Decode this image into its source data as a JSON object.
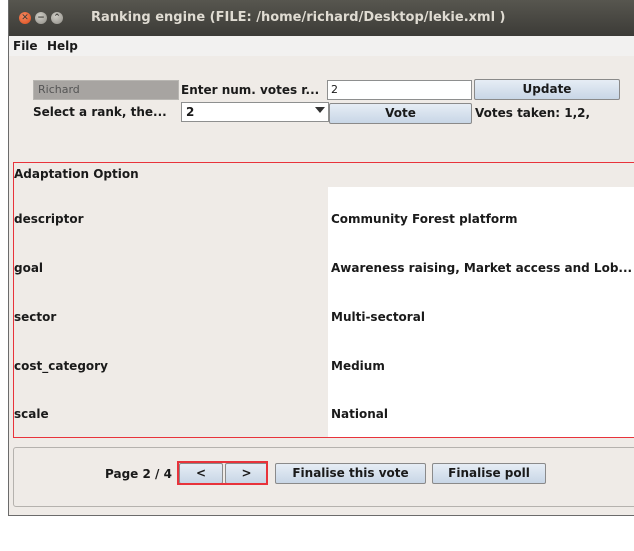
{
  "window": {
    "title": "Ranking engine  (FILE: /home/richard/Desktop/lekie.xml )",
    "close_glyph": "✕",
    "min_glyph": "−",
    "max_glyph": "⌃"
  },
  "menu": {
    "file": "File",
    "help": "Help"
  },
  "form": {
    "name_value": "Richard",
    "votes_label": "Enter num. votes r...",
    "votes_value": "2",
    "update_label": "Update",
    "rank_label": "Select a rank, the...",
    "rank_selected": "2",
    "vote_label": "Vote",
    "votes_taken": "Votes taken: 1,2,"
  },
  "panel": {
    "title": "Adaptation Option",
    "rows": [
      {
        "key": "descriptor",
        "value": "Community Forest platform"
      },
      {
        "key": "goal",
        "value": "Awareness raising, Market access and Lob..."
      },
      {
        "key": "sector",
        "value": "Multi-sectoral"
      },
      {
        "key": "cost_category",
        "value": "Medium"
      },
      {
        "key": "scale",
        "value": "National"
      }
    ]
  },
  "pager": {
    "page_label": "Page 2 / 4",
    "prev_label": "<",
    "next_label": ">",
    "finalise_vote_label": "Finalise this vote",
    "finalise_poll_label": "Finalise poll"
  },
  "colors": {
    "highlight": "#e8333b",
    "button_top": "#e6edf5",
    "button_bottom": "#c8d6e6"
  }
}
